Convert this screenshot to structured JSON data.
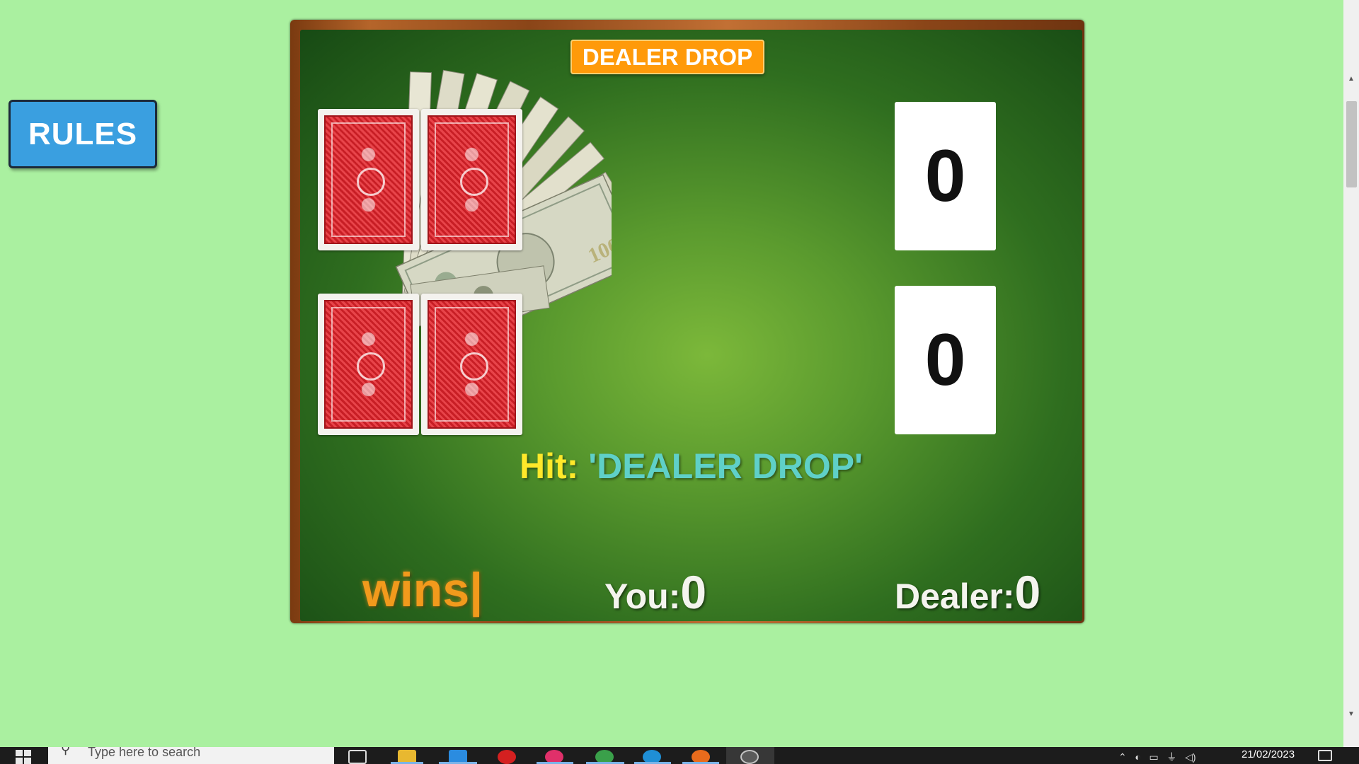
{
  "rules_button": {
    "label": "RULES"
  },
  "game": {
    "dealer_drop_button": {
      "label": "DEALER DROP"
    },
    "player_cards": [
      "card-back",
      "card-back",
      "card-back",
      "card-back"
    ],
    "score_boxes": {
      "top": "0",
      "bottom": "0"
    },
    "hit": {
      "label": "Hit:",
      "value": "'DEALER DROP'"
    },
    "wins_text": "wins|",
    "you": {
      "label": "You:",
      "value": "0"
    },
    "dealer": {
      "label": "Dealer:",
      "value": "0"
    }
  },
  "taskbar": {
    "search_placeholder": "Type here to search",
    "date": "21/02/2023"
  },
  "colors": {
    "page_background": "#aaf0a0",
    "rules_button": "#3a9fe0",
    "dealer_drop_button": "#ff9a0a",
    "hit_label": "#ffe82a",
    "hit_value": "#5fd0c8",
    "wins_text": "#f29a1c",
    "card_back": "#c81e25"
  },
  "icons": [
    "money-fan-icon",
    "card-back-icon",
    "windows-start-icon",
    "search-icon",
    "task-view-icon",
    "file-explorer-icon",
    "vscode-icon",
    "opera-icon",
    "app-icon",
    "chrome-icon",
    "edge-icon",
    "firefox-icon",
    "media-icon",
    "notification-icon"
  ]
}
